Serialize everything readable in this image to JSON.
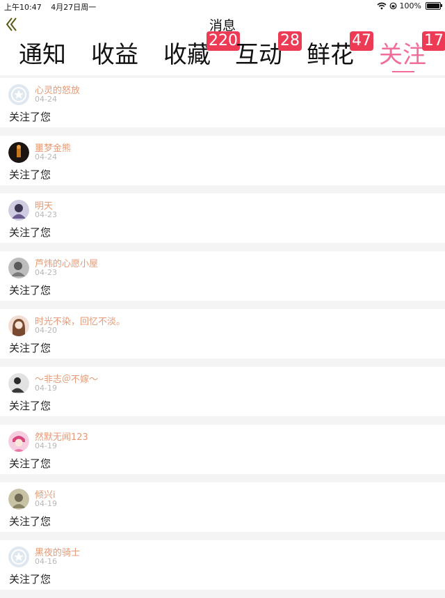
{
  "status": {
    "time": "上午10:47",
    "date": "4月27日周一",
    "battery": "100%"
  },
  "nav": {
    "title": "消息"
  },
  "tabs": [
    {
      "label": "通知",
      "badge": ""
    },
    {
      "label": "收益",
      "badge": ""
    },
    {
      "label": "收藏",
      "badge": "220"
    },
    {
      "label": "互动",
      "badge": "28"
    },
    {
      "label": "鲜花",
      "badge": "47"
    },
    {
      "label": "关注",
      "badge": "17"
    }
  ],
  "active_tab": "关注",
  "accent_color": "#f06d9c",
  "badge_color": "#ee3b55",
  "name_color": "#e59a75",
  "items": [
    {
      "name": "心灵的怒放",
      "date": "04-24",
      "message": "关注了您"
    },
    {
      "name": "噩梦金熊",
      "date": "04-24",
      "message": "关注了您"
    },
    {
      "name": "明天",
      "date": "04-23",
      "message": "关注了您"
    },
    {
      "name": "芦炜的心愿小屋",
      "date": "04-23",
      "message": "关注了您"
    },
    {
      "name": "时光不染，回忆不淡。",
      "date": "04-20",
      "message": "关注了您"
    },
    {
      "name": "～非志＠不嫁～",
      "date": "04-19",
      "message": "关注了您"
    },
    {
      "name": "然默无闻123",
      "date": "04-19",
      "message": "关注了您"
    },
    {
      "name": "倾兴i",
      "date": "04-19",
      "message": "关注了您"
    },
    {
      "name": "黑夜的骑士",
      "date": "04-16",
      "message": "关注了您"
    }
  ]
}
